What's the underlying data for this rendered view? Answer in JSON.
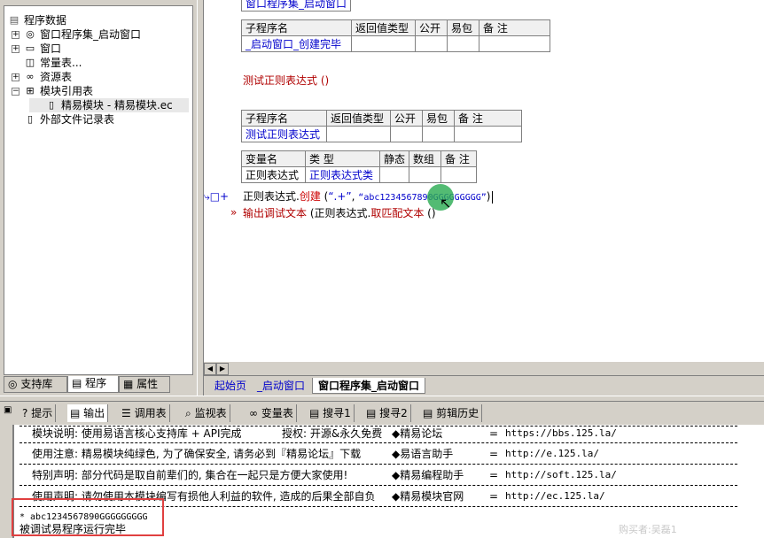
{
  "tree": {
    "root": "程序数据",
    "items": [
      {
        "label": "窗口程序集_启动窗口",
        "icon": "assembly-icon"
      },
      {
        "label": "窗口",
        "icon": "window-icon"
      },
      {
        "label": "常量表...",
        "icon": "constant-icon"
      },
      {
        "label": "资源表",
        "icon": "resource-icon"
      },
      {
        "label": "模块引用表",
        "icon": "module-icon"
      },
      {
        "label": "精易模块 - 精易模块.ec",
        "icon": "file-icon"
      },
      {
        "label": "外部文件记录表",
        "icon": "file-icon"
      }
    ]
  },
  "left_tabs": [
    "支持库",
    "程序",
    "属性"
  ],
  "editor": {
    "top_cut_text": "窗口程序集_启动窗口",
    "table1": {
      "headers": [
        "子程序名",
        "返回值类型",
        "公开",
        "易包",
        "备 注"
      ],
      "row": [
        "_启动窗口_创建完毕",
        "",
        "",
        "",
        ""
      ]
    },
    "call_line": "测试正则表达式 ()",
    "table2": {
      "headers": [
        "子程序名",
        "返回值类型",
        "公开",
        "易包",
        "备 注"
      ],
      "row": [
        "测试正则表达式",
        "",
        "",
        "",
        ""
      ]
    },
    "table3": {
      "headers": [
        "变量名",
        "类 型",
        "静态",
        "数组",
        "备 注"
      ],
      "row": [
        "正则表达式",
        "正则表达式类",
        "",
        "",
        ""
      ]
    },
    "code1": {
      "obj": "正则表达式.",
      "method": "创建",
      "open": " (",
      "arg1": "“.+”",
      "sep": ", ",
      "arg2": "“abc1234567890GGGGGGGGG”",
      "close": ")"
    },
    "code2": {
      "method": "输出调试文本",
      "open": " (",
      "obj": "正则表达式.",
      "call": "取匹配文本",
      "rest": " ()"
    }
  },
  "editor_tabs": [
    "起始页",
    "_启动窗口",
    "窗口程序集_启动窗口"
  ],
  "bottom_tabs": [
    "提示",
    "输出",
    "调用表",
    "监视表",
    "变量表",
    "搜寻1",
    "搜寻2",
    "剪辑历史"
  ],
  "output": {
    "lines": [
      {
        "left": "模块说明: 使用易语言核心支持库 + API完成",
        "mid": "授权: 开源&永久免费",
        "site": "◆精易论坛",
        "eq": "=",
        "url": "https://bbs.125.la/"
      },
      {
        "left": "使用注意: 精易模块纯绿色, 为了确保安全, 请务必到『精易论坛』下载",
        "site": "◆易语言助手",
        "eq": "=",
        "url": "http://e.125.la/"
      },
      {
        "left": "特别声明: 部分代码是取自前辈们的, 集合在一起只是方便大家使用!",
        "site": "◆精易编程助手",
        "eq": "=",
        "url": "http://soft.125.la/"
      },
      {
        "left": "使用声明: 请勿使用本模块编写有损他人利益的软件, 造成的后果全部自负",
        "site": "◆精易模块官网",
        "eq": "=",
        "url": "http://ec.125.la/"
      }
    ],
    "result": "* abc1234567890GGGGGGGGG",
    "done": "被调试易程序运行完毕"
  },
  "watermark": "购买者:吴磊1",
  "colors": {
    "highlight_box": "#e04040",
    "cursor_dot": "#28aa50",
    "link_blue": "#0000cc",
    "keyword_red": "#cc0000"
  }
}
